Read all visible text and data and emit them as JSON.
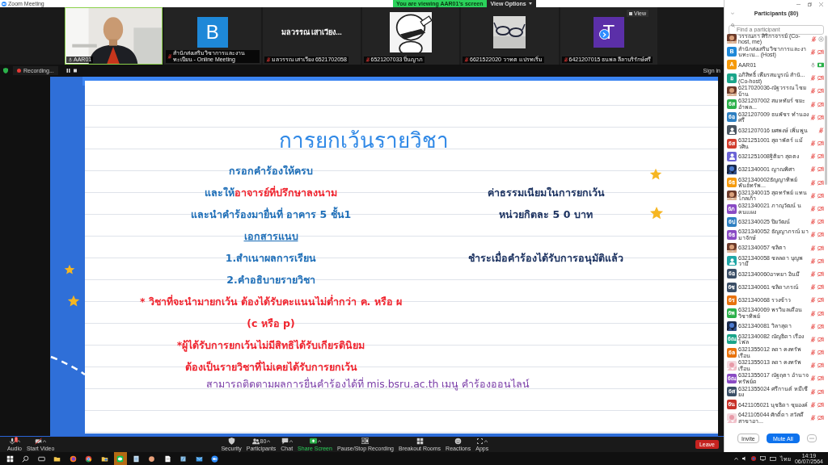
{
  "window": {
    "title": "Zoom Meeting"
  },
  "share_banner": {
    "text": "You are viewing AAR01's screen",
    "options": "View Options"
  },
  "video_strip": {
    "view_button": "View",
    "tiles": [
      {
        "kind": "video",
        "name": "AAR01",
        "speaking": true,
        "muted": false
      },
      {
        "kind": "letter",
        "letter": "B",
        "color": "#1e88d8",
        "name": "สำนักส่งเสริมวิชาการและงานทะเบียน - Online Meeting",
        "speaking": false,
        "muted": true
      },
      {
        "kind": "name",
        "display": "มลวรรณ เสาเวียง...",
        "name": "มลวรรณ เสาเวียง 6521702058",
        "speaking": false,
        "muted": true
      },
      {
        "kind": "picture",
        "name": "6521207033 ปิ่นญาภ",
        "speaking": false,
        "muted": true
      },
      {
        "kind": "picture",
        "name": "6621522020 วาทต แปรทเริ่ม",
        "speaking": false,
        "muted": true
      },
      {
        "kind": "letter",
        "letter": "T",
        "color": "#5b2fa8",
        "name": "6421207015 ธนพล ลีลาบริรักษ์ศรี",
        "speaking": false,
        "muted": true
      }
    ]
  },
  "recording": {
    "label": "Recording..."
  },
  "sign_in": "Sign in",
  "slide": {
    "title": "การยกเว้นรายวิชา",
    "left_lines": [
      {
        "underline": false,
        "segments": [
          {
            "text": "กรอกคำร้องให้ครบ",
            "color": "#1f6fb8"
          }
        ]
      },
      {
        "underline": false,
        "segments": [
          {
            "text": "และให้",
            "color": "#1f6fb8"
          },
          {
            "text": "อาจารย์ที่ปรึกษาลงนาม",
            "color": "#f0252f"
          }
        ]
      },
      {
        "underline": false,
        "segments": [
          {
            "text": "และนำคำร้องมายื่นที่ อาคาร 5 ชั้น1",
            "color": "#1f6fb8"
          }
        ]
      },
      {
        "underline": true,
        "segments": [
          {
            "text": "เอกสารแนบ",
            "color": "#1f6fb8"
          }
        ]
      },
      {
        "underline": false,
        "segments": [
          {
            "text": "1.สำเนาผลการเรียน",
            "color": "#1f6fb8"
          }
        ]
      },
      {
        "underline": false,
        "segments": [
          {
            "text": "2.คำอธิบายรายวิชา",
            "color": "#1f6fb8"
          }
        ]
      },
      {
        "underline": false,
        "segments": [
          {
            "text": "* วิชาที่จะนำมายกเว้น ต้องได้รับคะแนนไม่ต่ำกว่า ค. หรือ ผ",
            "color": "#f0252f"
          }
        ]
      },
      {
        "underline": false,
        "segments": [
          {
            "text": "(c หรือ p)",
            "color": "#f0252f"
          }
        ]
      },
      {
        "underline": false,
        "segments": [
          {
            "text": "*ผู้ได้รับการยกเว้นไม่มีสิทธิได้รับเกียรตินิยม",
            "color": "#f0252f"
          }
        ]
      },
      {
        "underline": false,
        "segments": [
          {
            "text": "ต้องเป็นรายวิชาที่ไม่เคยได้รับการยกเว้น",
            "color": "#f0252f"
          }
        ]
      }
    ],
    "right_lines": [
      {
        "underline": false,
        "segments": [
          {
            "text": "ค่าธรรมเนียมในการยกเว้น",
            "color": "#1d3361"
          }
        ]
      },
      {
        "underline": false,
        "segments": [
          {
            "text": "หน่วยกิตละ 5 0  บาท",
            "color": "#1d3361"
          }
        ]
      },
      {
        "underline": false,
        "segments": [
          {
            "text": "ชำระเมื่อคำร้องได้รับการอนุมัติแล้ว",
            "color": "#1d3361"
          }
        ]
      }
    ],
    "footer": {
      "underline": false,
      "segments": [
        {
          "text": "สามารถติดตามผลการยื่นคำร้องได้ที่ mis.bsru.ac.th  เมนู คำร้องออนไลน์",
          "color": "#7b3fa8"
        }
      ]
    }
  },
  "toolbar": {
    "items": [
      {
        "kind": "audio",
        "label": "Audio",
        "menu": true,
        "alert": "!"
      },
      {
        "kind": "video",
        "label": "Start Video",
        "menu": true
      },
      {
        "kind": "security",
        "label": "Security",
        "menu": false
      },
      {
        "kind": "participants",
        "label": "Participants",
        "count": "80",
        "menu": true
      },
      {
        "kind": "chat",
        "label": "Chat",
        "menu": true
      },
      {
        "kind": "share",
        "label": "Share Screen",
        "menu": true
      },
      {
        "kind": "record",
        "label": "Pause/Stop Recording",
        "menu": false
      },
      {
        "kind": "breakout",
        "label": "Breakout Rooms",
        "menu": false
      },
      {
        "kind": "reactions",
        "label": "Reactions",
        "menu": false
      },
      {
        "kind": "apps",
        "label": "Apps",
        "menu": true
      }
    ],
    "leave": "Leave"
  },
  "taskbar": {
    "apps": [
      {
        "kind": "windows",
        "selected": false
      },
      {
        "kind": "search",
        "selected": false
      },
      {
        "kind": "taskview",
        "selected": false
      },
      {
        "kind": "folder",
        "selected": false
      },
      {
        "kind": "firefox",
        "selected": false
      },
      {
        "kind": "chrome",
        "selected": false
      },
      {
        "kind": "folder-person",
        "selected": false
      },
      {
        "kind": "chat",
        "selected": true
      },
      {
        "kind": "notepad",
        "selected": false
      },
      {
        "kind": "ball",
        "selected": false
      },
      {
        "kind": "document",
        "selected": false
      },
      {
        "kind": "installer",
        "selected": false
      },
      {
        "kind": "mail",
        "selected": false
      },
      {
        "kind": "zoom",
        "selected": false
      }
    ],
    "language": "ไทย",
    "time": "14:19",
    "date": "06/07/2564"
  },
  "participants": {
    "title": "Participants (80)",
    "search_placeholder": "Find a participant",
    "buttons": [
      "Invite",
      "Mute All"
    ],
    "rows": [
      {
        "name": "วรรณภา ศิริกาจารย์ (Co-host, me)",
        "mic_muted": true,
        "video_muted": false,
        "video_on": false,
        "recording": true
      },
      {
        "name": "สำนักส่งเสริมวิชาการและงานทะเบ... (Host)",
        "avatar": {
          "kind": "initials",
          "text": "B",
          "color": "#1e88d8"
        },
        "mic_muted": true,
        "video_muted": true,
        "video_on": false,
        "recording": false
      },
      {
        "name": "AAR01",
        "avatar": {
          "kind": "initials",
          "text": "A",
          "color": "#f59a0c"
        },
        "mic_muted": false,
        "video_muted": false,
        "video_on": true,
        "recording": false
      },
      {
        "name": "อภิสิทธิ์ เพียรสมบูรณ์ สำนั... (Co-host)",
        "avatar": {
          "kind": "initials",
          "text": "อ",
          "color": "#1aa58a"
        },
        "mic_muted": true,
        "video_muted": true,
        "video_on": false,
        "recording": false
      },
      {
        "name": "6217020036-ณัฐวรรณ ไชยบ้าน",
        "mic_muted": true,
        "video_muted": true,
        "video_on": false,
        "recording": false
      },
      {
        "name": "6321207002 สมหทัยร์ ชยะอำพล...",
        "avatar": {
          "kind": "initials",
          "text": "6ส",
          "color": "#2bb04a"
        },
        "mic_muted": true,
        "video_muted": true,
        "video_on": false,
        "recording": false
      },
      {
        "name": "6321207009 ธนพัชร ทำนองศรี",
        "avatar": {
          "kind": "initials",
          "text": "6อ",
          "color": "#2d7fc1"
        },
        "mic_muted": true,
        "video_muted": true,
        "video_on": false,
        "recording": false
      },
      {
        "name": "6321207016 ยศพงษ์ เพิ่มพูน",
        "avatar": {
          "kind": "silhouette",
          "color": "#4a5560"
        },
        "mic_muted": true,
        "video_muted": false,
        "video_on": false,
        "recording": false
      },
      {
        "name": "6321251001 สุดาพัตร์ แม้วศิน",
        "avatar": {
          "kind": "initials",
          "text": "6ส",
          "color": "#d13b2c"
        },
        "mic_muted": true,
        "video_muted": true,
        "video_on": false,
        "recording": false
      },
      {
        "name": "6321251008ฐิติยา สุดตง",
        "avatar": {
          "kind": "silhouette",
          "color": "#6b63d6"
        },
        "mic_muted": true,
        "video_muted": true,
        "video_on": false,
        "recording": false
      },
      {
        "name": "6321340001 ญาณพิศา",
        "mic_muted": true,
        "video_muted": true,
        "video_on": false,
        "recording": false
      },
      {
        "name": "6321340002ธัญญาทิพย์ พันธ์ทรัพ...",
        "avatar": {
          "kind": "initials",
          "text": "6ธ",
          "color": "#f59a0c"
        },
        "mic_muted": true,
        "video_muted": true,
        "video_on": false,
        "recording": false
      },
      {
        "name": "6321340015 สุดทรัพย์ แทนไกลเก้า",
        "mic_muted": true,
        "video_muted": true,
        "video_on": false,
        "recording": false
      },
      {
        "name": "6321340021 ภาณุวัฒน์ นคนแผง",
        "avatar": {
          "kind": "initials",
          "text": "6ภ",
          "color": "#8a4bc4"
        },
        "mic_muted": true,
        "video_muted": true,
        "video_on": false,
        "recording": false
      },
      {
        "name": "6321340025 ปิยวัฒน์",
        "avatar": {
          "kind": "initials",
          "text": "6ป",
          "color": "#2d7fc1"
        },
        "mic_muted": true,
        "video_muted": true,
        "video_on": false,
        "recording": false
      },
      {
        "name": "6321340052 ธัญญาภรณ์ มามาจักษ์",
        "avatar": {
          "kind": "initials",
          "text": "6ธ",
          "color": "#8a4bc4"
        },
        "mic_muted": true,
        "video_muted": true,
        "video_on": false,
        "recording": false
      },
      {
        "name": "6321340057 ชลิตา",
        "mic_muted": true,
        "video_muted": true,
        "video_on": false,
        "recording": false
      },
      {
        "name": "6321340058 ชลลดา บุญพวามี",
        "avatar": {
          "kind": "silhouette",
          "color": "#1fa6a6"
        },
        "mic_muted": true,
        "video_muted": true,
        "video_on": false,
        "recording": false
      },
      {
        "name": "6321340060อาทยา อินมี",
        "avatar": {
          "kind": "initials",
          "text": "6อ",
          "color": "#3a4e66"
        },
        "mic_muted": true,
        "video_muted": true,
        "video_on": false,
        "recording": false
      },
      {
        "name": "6321340061 ชลิดาภรณ์",
        "avatar": {
          "kind": "initials",
          "text": "6ช",
          "color": "#3a4e66"
        },
        "mic_muted": true,
        "video_muted": true,
        "video_on": false,
        "recording": false
      },
      {
        "name": "6321340068 รวงข้าว",
        "avatar": {
          "kind": "initials",
          "text": "6ร",
          "color": "#e8720c"
        },
        "mic_muted": true,
        "video_muted": true,
        "video_on": false,
        "recording": false
      },
      {
        "name": "6321340069 พรวิมลเดือน วิชาทิพย์",
        "avatar": {
          "kind": "initials",
          "text": "6พ",
          "color": "#2bb04a"
        },
        "mic_muted": true,
        "video_muted": true,
        "video_on": false,
        "recording": false
      },
      {
        "name": "6321340081 วิลาสุดา",
        "mic_muted": true,
        "video_muted": true,
        "video_on": false,
        "recording": false
      },
      {
        "name": "6321340082 ณัญธิดา เรืองไพ่ล",
        "avatar": {
          "kind": "initials",
          "text": "6ณ",
          "color": "#1aa58a"
        },
        "mic_muted": true,
        "video_muted": true,
        "video_on": false,
        "recording": false
      },
      {
        "name": "6321355012 ลดา คงทรัพเรือน",
        "avatar": {
          "kind": "initials",
          "text": "6ล",
          "color": "#e8720c"
        },
        "mic_muted": true,
        "video_muted": true,
        "video_on": false,
        "recording": false
      },
      {
        "name": "6321355013 ลดา คงทรัพเรือน",
        "mic_muted": true,
        "video_muted": true,
        "video_on": false,
        "recording": false
      },
      {
        "name": "6321355017 ณัฐฤตา อำนาจทรัพย์ด",
        "avatar": {
          "kind": "initials",
          "text": "6ณ",
          "color": "#8a4bc4"
        },
        "mic_muted": true,
        "video_muted": true,
        "video_on": false,
        "recording": false
      },
      {
        "name": "6321355024 ศรีกานต์ หมีเซียง",
        "avatar": {
          "kind": "initials",
          "text": "6ศ",
          "color": "#3a4e66"
        },
        "mic_muted": true,
        "video_muted": true,
        "video_on": false,
        "recording": false
      },
      {
        "name": "6421105021 นุชธิดา ชุยองค์",
        "avatar": {
          "kind": "initials",
          "text": "6น",
          "color": "#c8322a"
        },
        "mic_muted": true,
        "video_muted": true,
        "video_on": false,
        "recording": false
      },
      {
        "name": "6421105044 ศักดิ์ดา สวัสดี สาขาอา...",
        "mic_muted": true,
        "video_muted": true,
        "video_on": false,
        "recording": false
      }
    ]
  }
}
